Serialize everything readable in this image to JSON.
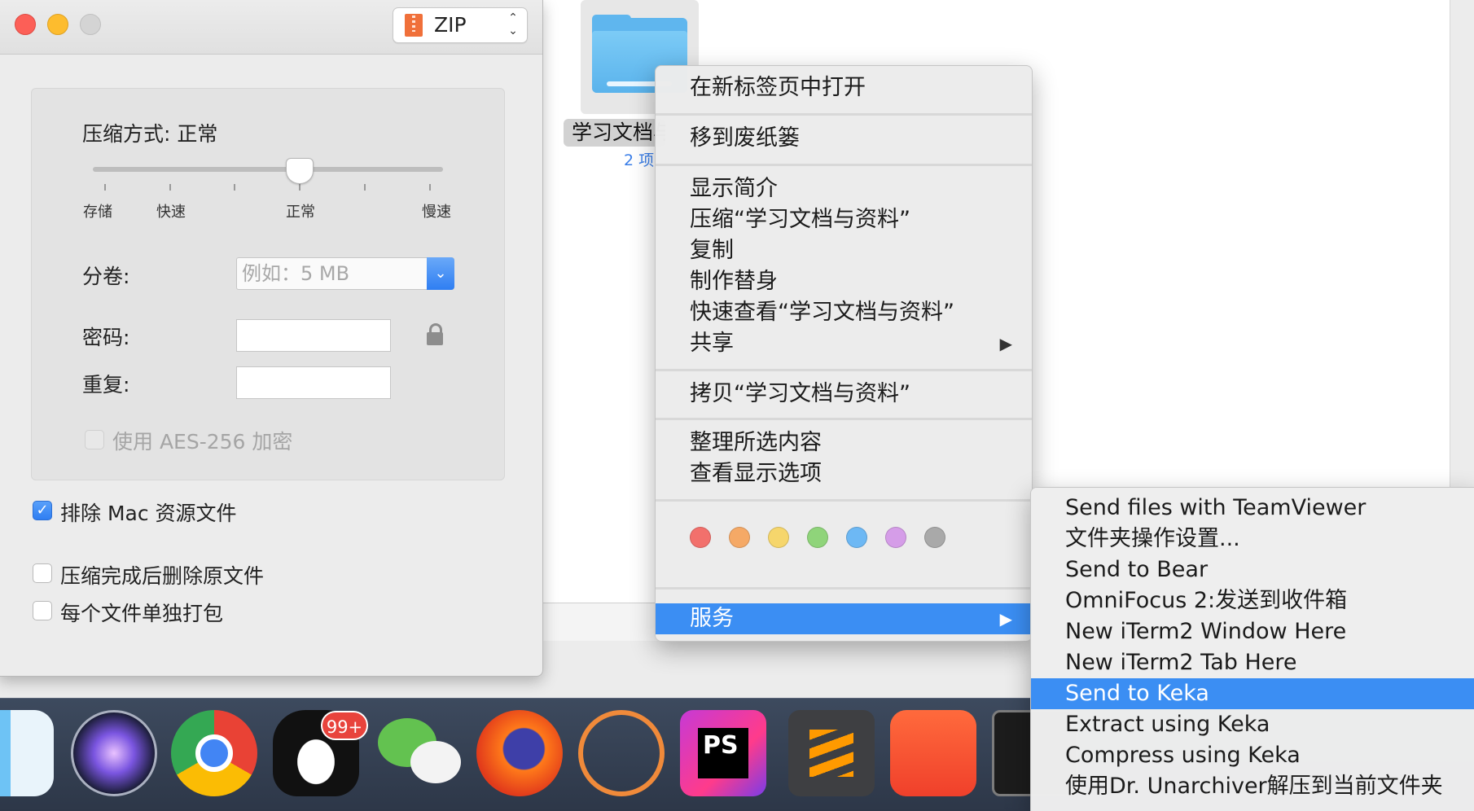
{
  "dialog": {
    "format_select": {
      "value": "ZIP"
    },
    "compression": {
      "label": "压缩方式: 正常",
      "slider_labels": [
        "存储",
        "快速",
        "正常",
        "慢速"
      ],
      "level_fraction": 0.59
    },
    "split": {
      "label": "分卷:",
      "placeholder": "例如：5 MB"
    },
    "password": {
      "label": "密码:"
    },
    "repeat": {
      "label": "重复:"
    },
    "aes": {
      "label": "使用 AES-256 加密",
      "checked": false,
      "disabled": true
    },
    "exclude_mac": {
      "label": "排除 Mac 资源文件",
      "checked": true
    },
    "delete_after": {
      "label": "压缩完成后删除原文件",
      "checked": false
    },
    "pack_each": {
      "label": "每个文件单独打包",
      "checked": false
    }
  },
  "finder": {
    "folder_name": "学习文档与资料",
    "folder_sub": "2 项"
  },
  "context_menu": {
    "items": [
      {
        "label": "在新标签页中打开"
      },
      {
        "label": "移到废纸篓"
      },
      {
        "label": "显示简介"
      },
      {
        "label": "压缩“学习文档与资料”"
      },
      {
        "label": "复制"
      },
      {
        "label": "制作替身"
      },
      {
        "label": "快速查看“学习文档与资料”"
      },
      {
        "label": "共享",
        "submenu_arrow": "▶"
      },
      {
        "label": "拷贝“学习文档与资料”"
      },
      {
        "label": "整理所选内容"
      },
      {
        "label": "查看显示选项"
      },
      {
        "label": "服务",
        "submenu_arrow": "▶",
        "selected": true
      }
    ],
    "tag_colors": [
      "#f2706c",
      "#f5a966",
      "#f6d66c",
      "#8fd47a",
      "#6db8f4",
      "#d59de8",
      "#a9a9a9"
    ]
  },
  "services_menu": {
    "items": [
      {
        "label": "Send files with TeamViewer"
      },
      {
        "label": "文件夹操作设置..."
      },
      {
        "label": "Send to Bear"
      },
      {
        "label": "OmniFocus 2:发送到收件箱"
      },
      {
        "label": "New iTerm2 Window Here"
      },
      {
        "label": "New iTerm2 Tab Here"
      },
      {
        "label": "Send to Keka",
        "selected": true
      },
      {
        "label": "Extract using Keka"
      },
      {
        "label": "Compress using Keka"
      },
      {
        "label": "使用Dr. Unarchiver解压到当前文件夹"
      }
    ]
  },
  "dock": {
    "apps": [
      "finder-icon",
      "siri-icon",
      "chrome-icon",
      "qq-icon",
      "wechat-icon",
      "firefox-icon",
      "navicat-icon",
      "phpstorm-icon",
      "sublime-text-icon",
      "video-app-icon",
      "iterm-icon"
    ],
    "qq_badge": "99+",
    "phpstorm_label": "PS"
  },
  "colors": {
    "selection": "#3b8ef3",
    "accent": "#2f7ef2"
  }
}
